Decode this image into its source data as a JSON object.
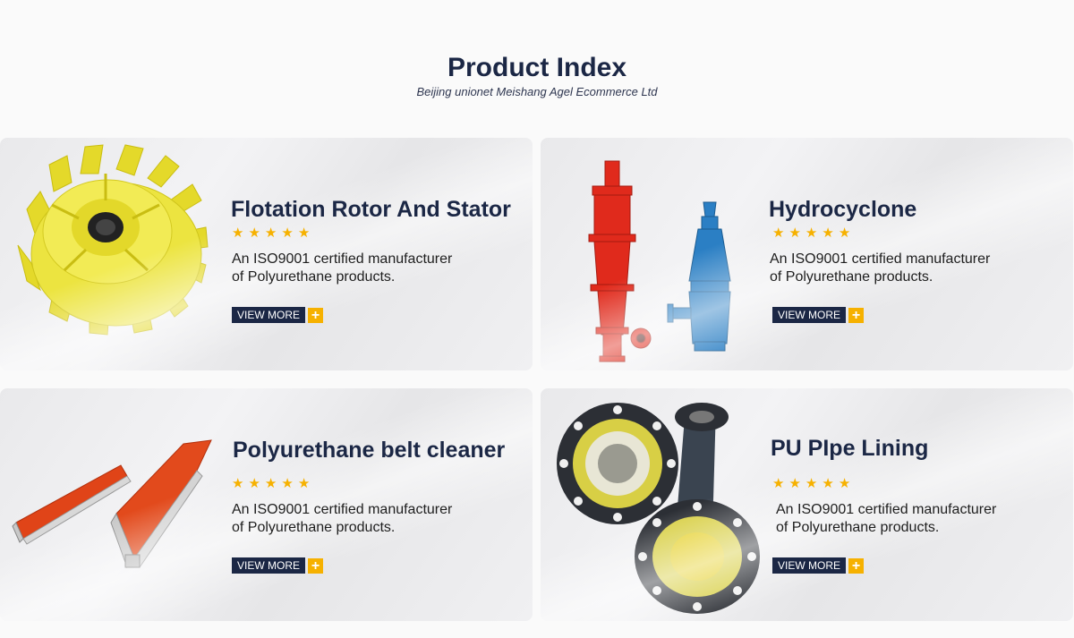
{
  "header": {
    "title": "Product Index",
    "subtitle": "Beijing unionet Meishang Agel Ecommerce Ltd"
  },
  "colors": {
    "navy": "#1b2745",
    "accent": "#f6b100"
  },
  "products": [
    {
      "title": "Flotation Rotor And Stator",
      "rating": 5,
      "desc_line1": "An ISO9001 certified manufacturer",
      "desc_line2": "of Polyurethane products.",
      "button_label": "VIEW MORE",
      "button_plus": "+",
      "image_icon": "flotation-rotor-image"
    },
    {
      "title": "Hydrocyclone",
      "rating": 5,
      "desc_line1": "An ISO9001 certified manufacturer",
      "desc_line2": "of Polyurethane products.",
      "button_label": "VIEW MORE",
      "button_plus": "+",
      "image_icon": "hydrocyclone-image"
    },
    {
      "title": "Polyurethane belt cleaner",
      "rating": 5,
      "desc_line1": "An ISO9001 certified manufacturer",
      "desc_line2": "of Polyurethane products.",
      "button_label": "VIEW MORE",
      "button_plus": "+",
      "image_icon": "belt-cleaner-image"
    },
    {
      "title": "PU PIpe Lining",
      "rating": 5,
      "desc_line1": "An ISO9001 certified manufacturer",
      "desc_line2": "of Polyurethane products.",
      "button_label": "VIEW MORE",
      "button_plus": "+",
      "image_icon": "pipe-lining-image"
    }
  ]
}
